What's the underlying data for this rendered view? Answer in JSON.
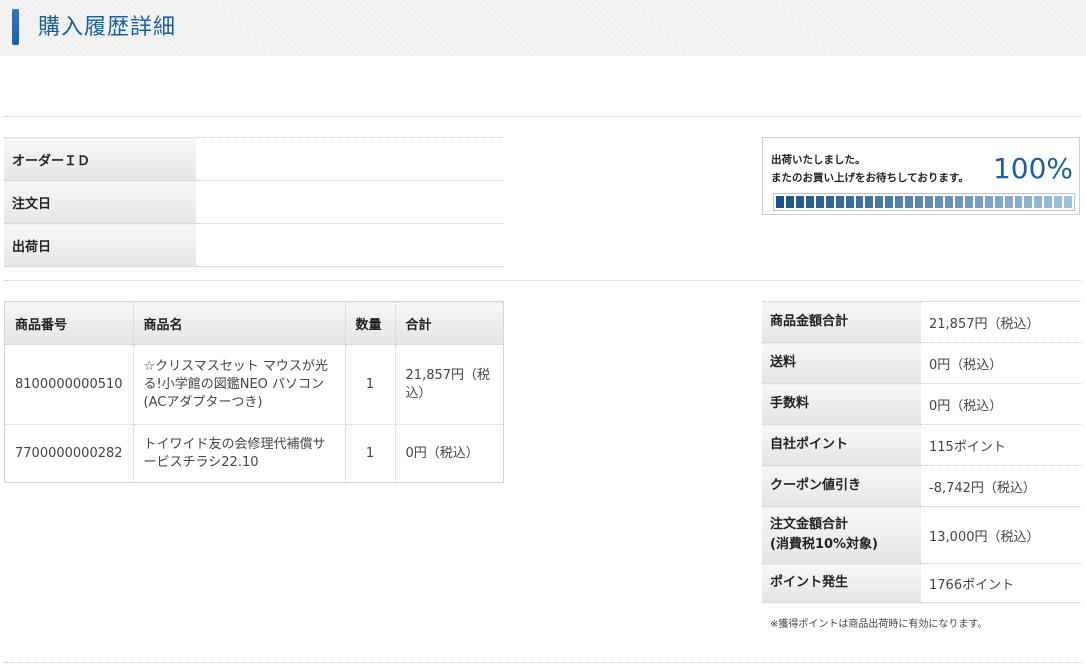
{
  "page": {
    "title": "購入履歴詳細"
  },
  "order_info": [
    {
      "label": "オーダーＩＤ",
      "value": ""
    },
    {
      "label": "注文日",
      "value": ""
    },
    {
      "label": "出荷日",
      "value": ""
    }
  ],
  "status": {
    "line1": "出荷いたしました。",
    "line2": "またのお買い上げをお待ちしております。",
    "percent_label": "100%",
    "progress": 1.0,
    "colors": {
      "start": "#1a5290",
      "end": "#9ec0e0",
      "text": "#1d5f9c"
    }
  },
  "items": {
    "headers": {
      "sku": "商品番号",
      "name": "商品名",
      "qty": "数量",
      "total": "合計"
    },
    "rows": [
      {
        "sku": "8100000000510",
        "name": "☆クリスマスセット マウスが光る!小学館の図鑑NEO パソコン (ACアダプターつき)",
        "qty": "1",
        "total": "21,857円（税込）"
      },
      {
        "sku": "7700000000282",
        "name": "トイワイド友の会修理代補償サービスチラシ22.10",
        "qty": "1",
        "total": "0円（税込）"
      }
    ]
  },
  "summary": [
    {
      "label": "商品金額合計",
      "value": "21,857円（税込）"
    },
    {
      "label": "送料",
      "value": "0円（税込）"
    },
    {
      "label": "手数料",
      "value": "0円（税込）"
    },
    {
      "label": "自社ポイント",
      "value": "115ポイント"
    },
    {
      "label": "クーポン値引き",
      "value": "-8,742円（税込）"
    },
    {
      "label": "注文金額合計",
      "label2": "(消費税10%対象)",
      "value": "13,000円（税込）"
    },
    {
      "label": "ポイント発生",
      "value": "1766ポイント"
    }
  ],
  "note": "※獲得ポイントは商品出荷時に有効になります。"
}
